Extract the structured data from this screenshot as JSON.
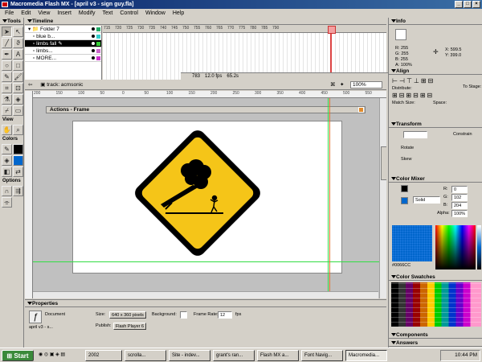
{
  "window": {
    "title": "Macromedia Flash MX - [april v3 - sign guy.fla]"
  },
  "menu": [
    "File",
    "Edit",
    "View",
    "Insert",
    "Modify",
    "Text",
    "Control",
    "Window",
    "Help"
  ],
  "tools": {
    "header": "Tools",
    "view_label": "View",
    "colors_label": "Colors",
    "options_label": "Options"
  },
  "timeline": {
    "header": "Timeline",
    "ruler": [
      "715",
      "720",
      "725",
      "730",
      "735",
      "740",
      "745",
      "750",
      "755",
      "760",
      "765",
      "770",
      "775",
      "780",
      "785",
      "790"
    ],
    "layers": [
      {
        "name": "Folder 7",
        "color": "#22aa66"
      },
      {
        "name": "blue b...",
        "color": "#33cccc"
      },
      {
        "name": "limbs fall",
        "color": "#33cc33",
        "active": true
      },
      {
        "name": "limbs...",
        "color": "#cc66cc"
      },
      {
        "name": "MORE...",
        "color": "#cc33cc"
      }
    ],
    "status": {
      "frame": "783",
      "fps": "12.0 fps",
      "time": "65.2s"
    }
  },
  "editbar": {
    "scene": "track: acmsonic",
    "zoom": "100%"
  },
  "stage": {
    "ruler": [
      "200",
      "150",
      "100",
      "50",
      "0",
      "50",
      "100",
      "150",
      "200",
      "250",
      "300",
      "350",
      "400",
      "450",
      "500",
      "550"
    ],
    "actions_title": "Actions - Frame"
  },
  "properties": {
    "header": "Properties",
    "doc_type": "Document",
    "doc_name": "april v3 - s...",
    "size_label": "Size:",
    "size_value": "640 x 360 pixels",
    "bg_label": "Background:",
    "rate_label": "Frame Rate:",
    "rate_value": "12",
    "fps_unit": "fps",
    "publish_label": "Publish:",
    "publish_value": "Flash Player 6"
  },
  "info": {
    "header": "Info",
    "r": "R: 255",
    "g": "G: 255",
    "b": "B: 255",
    "a": "A: 100%",
    "x": "X: 599.5",
    "y": "Y: 399.0"
  },
  "align": {
    "header": "Align",
    "distribute": "Distribute:",
    "match": "Match Size:",
    "space": "Space:",
    "to_stage": "To Stage:"
  },
  "transform": {
    "header": "Transform",
    "rotate": "Rotate",
    "skew": "Skew",
    "constrain": "Constrain"
  },
  "mixer": {
    "header": "Color Mixer",
    "fill": "Solid",
    "r": "0",
    "g": "102",
    "b": "204",
    "alpha": "100%",
    "hex": "#0066CC"
  },
  "swatches": {
    "header": "Color Swatches"
  },
  "components": {
    "header": "Components"
  },
  "answers": {
    "header": "Answers"
  },
  "taskbar": {
    "start": "Start",
    "buttons": [
      "2002",
      "scrolla...",
      "Site - indev...",
      "grant's ran...",
      "Flash MX a...",
      "Font Navig...",
      "Macromedia..."
    ],
    "time": "10:44 PM"
  },
  "colors": {
    "sign_yellow": "#f5c518",
    "accent_blue": "#0066cc"
  }
}
